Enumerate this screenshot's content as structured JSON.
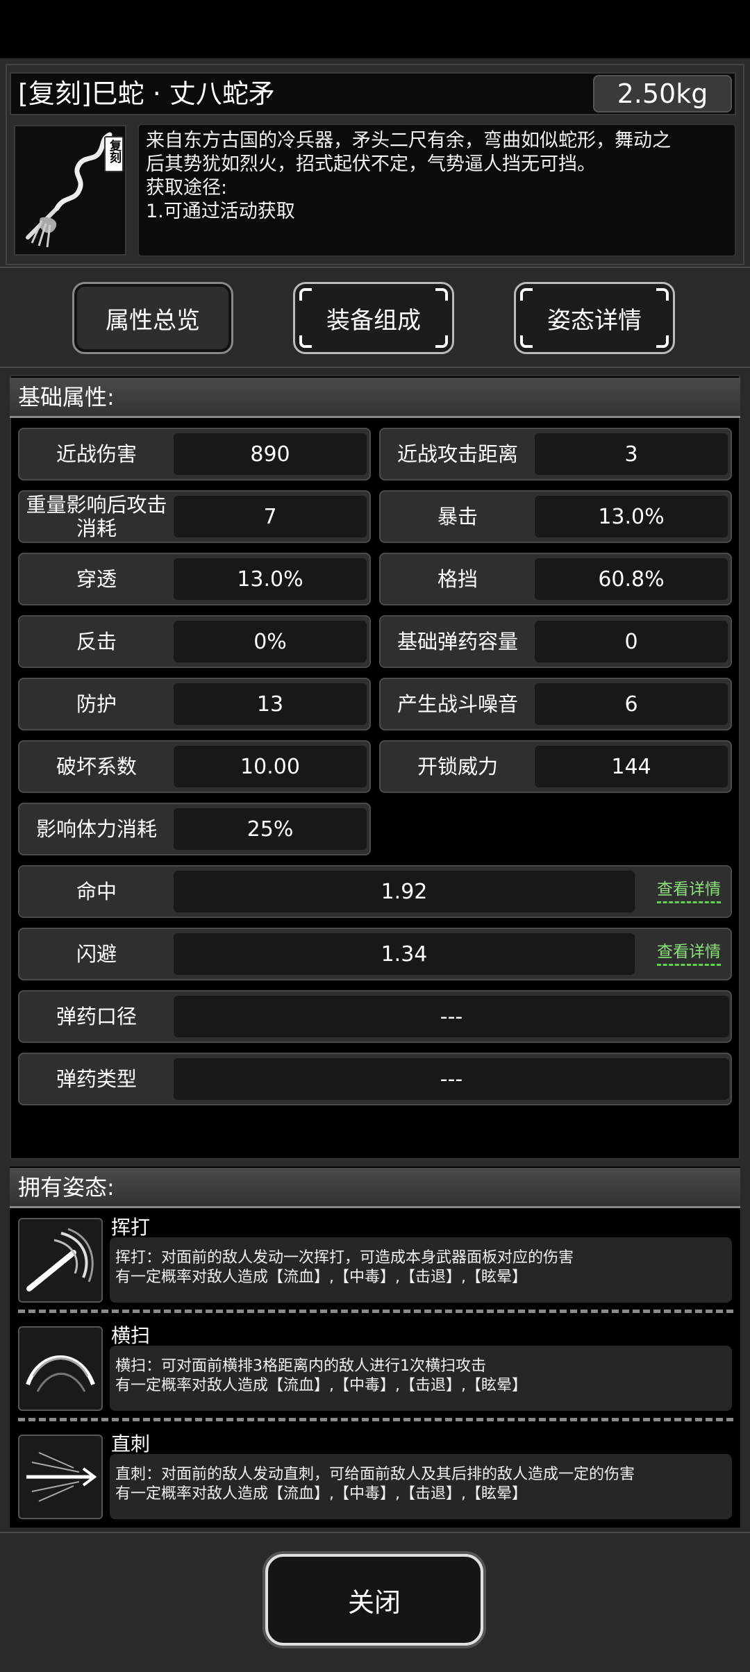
{
  "item": {
    "title": "[复刻]巳蛇 · 丈八蛇矛",
    "weight": "2.50kg",
    "icon": "serpent-spear-icon",
    "icon_stamp": "复刻",
    "desc_lines": [
      "来自东方古国的冷兵器，矛头二尺有余，弯曲如似蛇形，舞动之",
      "后其势犹如烈火，招式起伏不定，气势逼人挡无可挡。",
      "获取途径:",
      "1.可通过活动获取"
    ]
  },
  "tabs": [
    {
      "label": "属性总览",
      "selected": true
    },
    {
      "label": "装备组成",
      "selected": false
    },
    {
      "label": "姿态详情",
      "selected": false
    }
  ],
  "attributes": {
    "heading": "基础属性:",
    "rows": [
      [
        {
          "label": "近战伤害",
          "value": "890"
        },
        {
          "label": "近战攻击距离",
          "value": "3"
        }
      ],
      [
        {
          "label": "重量影响后攻击消耗",
          "value": "7"
        },
        {
          "label": "暴击",
          "value": "13.0%"
        }
      ],
      [
        {
          "label": "穿透",
          "value": "13.0%"
        },
        {
          "label": "格挡",
          "value": "60.8%"
        }
      ],
      [
        {
          "label": "反击",
          "value": "0%"
        },
        {
          "label": "基础弹药容量",
          "value": "0"
        }
      ],
      [
        {
          "label": "防护",
          "value": "13"
        },
        {
          "label": "产生战斗噪音",
          "value": "6"
        }
      ],
      [
        {
          "label": "破坏系数",
          "value": "10.00"
        },
        {
          "label": "开锁威力",
          "value": "144"
        }
      ],
      [
        {
          "label": "影响体力消耗",
          "value": "25%"
        }
      ]
    ],
    "wide_rows": [
      {
        "label": "命中",
        "value": "1.92",
        "link": "查看详情"
      },
      {
        "label": "闪避",
        "value": "1.34",
        "link": "查看详情"
      },
      {
        "label": "弹药口径",
        "value": "---"
      },
      {
        "label": "弹药类型",
        "value": "---"
      }
    ]
  },
  "stances": {
    "heading": "拥有姿态:",
    "items": [
      {
        "name": "挥打",
        "icon": "swing-icon",
        "line1": "挥打：对面前的敌人发动一次挥打，可造成本身武器面板对应的伤害",
        "line2": "有一定概率对敌人造成【流血】,【中毒】,【击退】,【眩晕】"
      },
      {
        "name": "横扫",
        "icon": "sweep-icon",
        "line1": "横扫：可对面前横排3格距离内的敌人进行1次横扫攻击",
        "line2": "有一定概率对敌人造成【流血】,【中毒】,【击退】,【眩晕】"
      },
      {
        "name": "直刺",
        "icon": "thrust-icon",
        "line1": "直刺：对面前的敌人发动直刺，可给面前敌人及其后排的敌人造成一定的伤害",
        "line2": "有一定概率对敌人造成【流血】,【中毒】,【击退】,【眩晕】"
      }
    ]
  },
  "close_label": "关闭"
}
